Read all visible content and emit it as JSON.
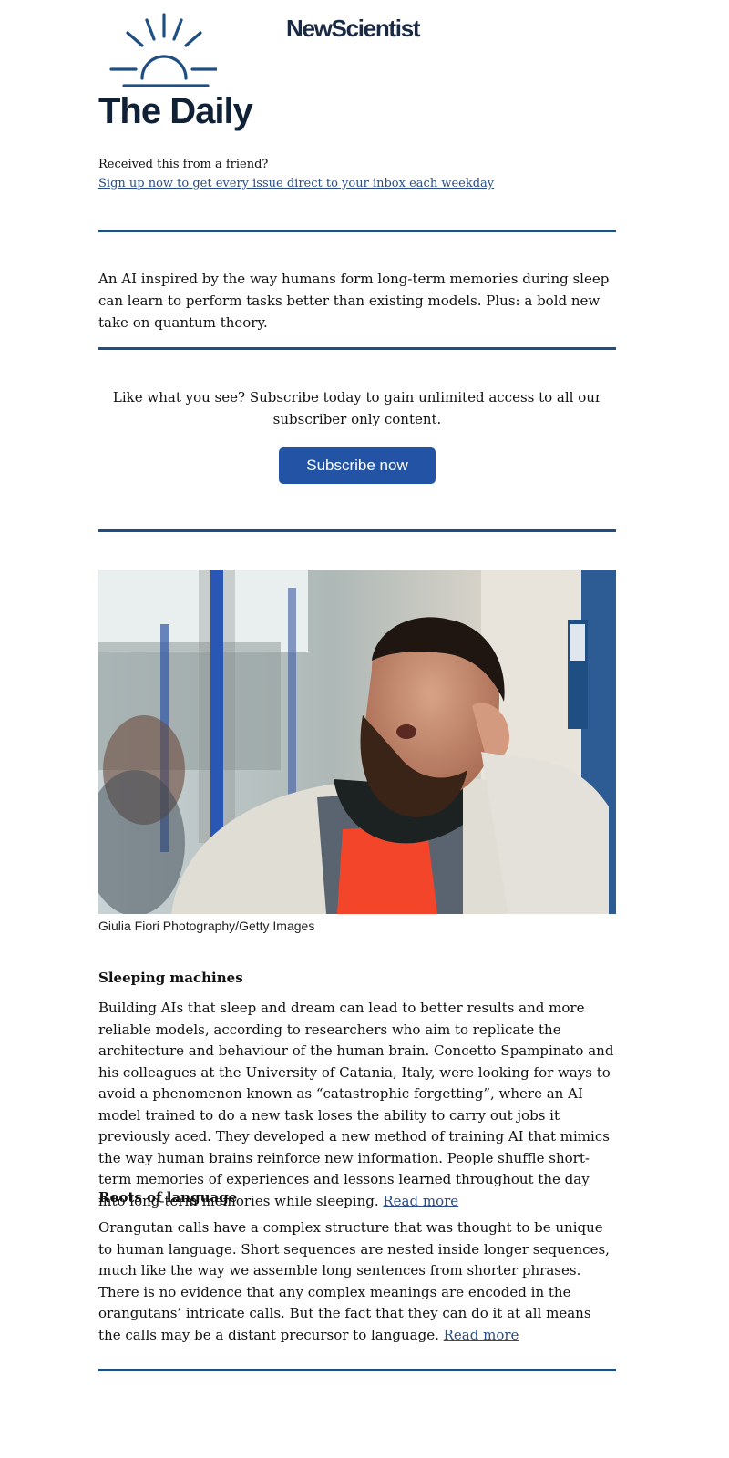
{
  "header": {
    "brand": "NewScientist",
    "title": "The Daily",
    "friend_text": "Received this from a friend?",
    "signup_link": "Sign up now to get every issue direct to your inbox each weekday"
  },
  "intro": "An AI inspired by the way humans form long-term memories during sleep can learn to perform tasks better than existing models. Plus: a bold new take on quantum theory.",
  "promo": {
    "text": "Like what you see? Subscribe today to gain unlimited access to all our subscriber only content.",
    "button": "Subscribe now"
  },
  "photo": {
    "credit": "Giulia Fiori Photography/Getty Images"
  },
  "articles": [
    {
      "heading": "Sleeping machines",
      "body": "Building AIs that sleep and dream can lead to better results and more reliable models, according to researchers who aim to replicate the architecture and behaviour of the human brain. Concetto Spampinato and his colleagues at the University of Catania, Italy, were looking for ways to avoid a phenomenon known as “catastrophic forgetting”, where an AI model trained to do a new task loses the ability to carry out jobs it previously aced. They developed a new method of training AI that mimics the way human brains reinforce new information. People shuffle short-term memories of experiences and lessons learned throughout the day into long-term memories while sleeping.",
      "link": "Read more"
    },
    {
      "heading": "Roots of language",
      "body": "Orangutan calls have a complex structure that was thought to be unique to human language. Short sequences are nested inside longer sequences, much like the way we assemble long sentences from shorter phrases. There is no evidence that any complex meanings are encoded in the orangutans’ intricate calls. But the fact that they can do it at all means the calls may be a distant precursor to language.",
      "link": "Read more"
    }
  ],
  "colors": {
    "rule": "#1f4f82",
    "button": "#2253a5",
    "link": "#2a4d85",
    "title": "#102035"
  }
}
